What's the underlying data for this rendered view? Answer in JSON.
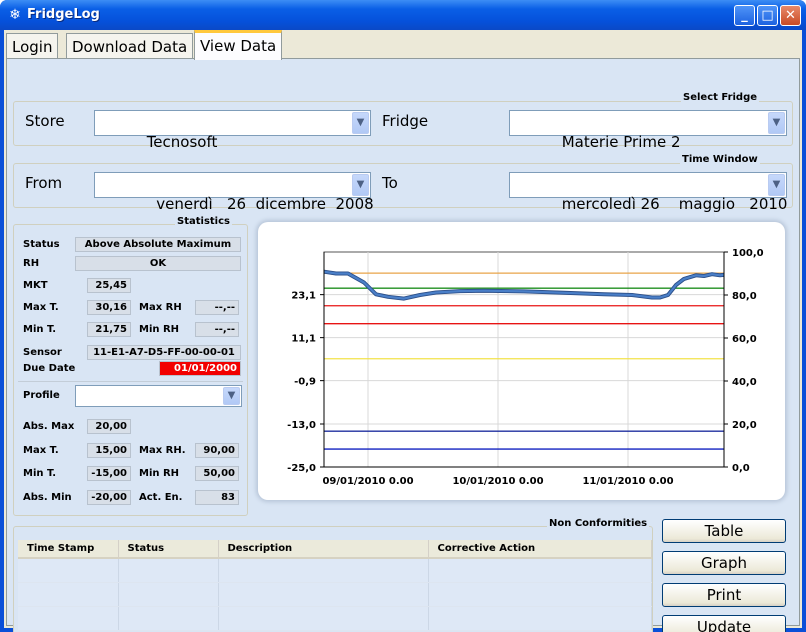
{
  "window": {
    "title": "FridgeLog",
    "icon": "snowflake-icon"
  },
  "tabs": [
    {
      "label": "Login"
    },
    {
      "label": "Download Data"
    },
    {
      "label": "View Data",
      "active": true
    }
  ],
  "select_fridge": {
    "group_title": "Select Fridge",
    "store_label": "Store",
    "store_value": "Tecnosoft",
    "fridge_label": "Fridge",
    "fridge_value": "Materie Prime 2"
  },
  "time_window": {
    "group_title": "Time Window",
    "from_label": "From",
    "from_value": "  venerdì   26  dicembre  2008",
    "to_label": "To",
    "to_value": "mercoledì 26    maggio   2010"
  },
  "statistics": {
    "group_title": "Statistics",
    "status_label": "Status",
    "status_value": "Above Absolute Maximum",
    "rh_label": "RH",
    "rh_value": "OK",
    "mkt_label": "MKT",
    "mkt_value": "25,45",
    "max_t_label": "Max T.",
    "max_t_value": "30,16",
    "max_rh_label": "Max RH",
    "max_rh_value": "--,--",
    "min_t_label": "Min T.",
    "min_t_value": "21,75",
    "min_rh_label": "Min RH",
    "min_rh_value": "--,--",
    "sensor_label": "Sensor",
    "sensor_value": "11-E1-A7-D5-FF-00-00-01",
    "due_date_label": "Due Date",
    "due_date_value": "01/01/2000"
  },
  "profile": {
    "label": "Profile",
    "value": "",
    "abs_max_label": "Abs. Max",
    "abs_max_value": "20,00",
    "max_t_label": "Max T.",
    "max_t_value": "15,00",
    "max_rh_label": "Max RH.",
    "max_rh_value": "90,00",
    "min_t_label": "Min T.",
    "min_t_value": "-15,00",
    "min_rh_label": "Min RH",
    "min_rh_value": "50,00",
    "abs_min_label": "Abs. Min",
    "abs_min_value": "-20,00",
    "act_en_label": "Act. En.",
    "act_en_value": "83"
  },
  "chart_data": {
    "type": "line",
    "y_left_ticks": [
      "23,1",
      "11,1",
      "-0,9",
      "-13,0",
      "-25,0"
    ],
    "y_left_values": [
      23.1,
      11.1,
      -0.9,
      -13.0,
      -25.0
    ],
    "y_right_ticks": [
      "100,0",
      "80,0",
      "60,0",
      "40,0",
      "20,0",
      "0,0"
    ],
    "y_right_values": [
      100,
      80,
      60,
      40,
      20,
      0
    ],
    "x_ticks": [
      "09/01/2010 0.00",
      "10/01/2010 0.00",
      "11/01/2010 0.00"
    ],
    "ylim_left": [
      -25.0,
      35.0
    ],
    "ylim_right": [
      0,
      100
    ],
    "grid": true,
    "series": [
      {
        "color": "#4a7fc8",
        "x": [
          0,
          0.03,
          0.06,
          0.1,
          0.13,
          0.16,
          0.2,
          0.24,
          0.28,
          0.34,
          0.4,
          0.5,
          0.6,
          0.7,
          0.77,
          0.82,
          0.84,
          0.86,
          0.88,
          0.9,
          0.93,
          0.95,
          0.97,
          0.99,
          1.0
        ],
        "values": [
          29.5,
          29.0,
          29.0,
          26.5,
          23.2,
          22.5,
          22.0,
          23.0,
          23.7,
          24.1,
          24.2,
          24.0,
          23.6,
          23.2,
          23.0,
          22.3,
          22.3,
          23.0,
          25.8,
          27.5,
          28.5,
          28.3,
          28.8,
          28.5,
          28.6
        ]
      }
    ],
    "reference_lines": [
      {
        "value": 29.1,
        "color": "#e8a448"
      },
      {
        "value": 24.9,
        "color": "#1f8f1f"
      },
      {
        "value": 20.0,
        "color": "#e81414"
      },
      {
        "value": 15.0,
        "color": "#e81414"
      },
      {
        "value": 5.2,
        "color": "#f2e24a"
      },
      {
        "value": -15.0,
        "color": "#1f2f9f"
      },
      {
        "value": -20.0,
        "color": "#1020c0"
      }
    ]
  },
  "non_conformities": {
    "group_title": "Non Conformities",
    "columns": [
      "Time Stamp",
      "Status",
      "Description",
      "Corrective Action"
    ]
  },
  "buttons": {
    "table": "Table",
    "graph": "Graph",
    "print": "Print",
    "update": "Update"
  },
  "colors": {
    "panel_bg": "#d9e5f4",
    "titlebar": "#0a5fe6",
    "alert_red": "#f20000"
  }
}
